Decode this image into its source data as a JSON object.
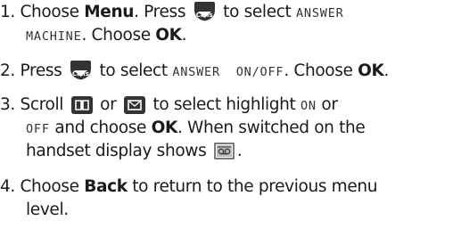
{
  "steps": [
    {
      "num": "1.",
      "l1a": "Choose ",
      "l1b": "Menu",
      "l1c": ". Press ",
      "l1d": " to select ",
      "l1e": "ANSWER",
      "l2a": "MACHINE",
      "l2b": ". Choose ",
      "l2c": "OK",
      "l2d": "."
    },
    {
      "num": "2.",
      "l1a": "Press ",
      "l1b": " to select ",
      "l1c": "ANSWER  ON/OFF",
      "l1d": ". Choose ",
      "l1e": "OK",
      "l1f": "."
    },
    {
      "num": "3.",
      "l1a": "Scroll ",
      "l1b": " or ",
      "l1c": " to select highlight ",
      "l1d": "ON",
      "l1e": " or",
      "l2a": "OFF",
      "l2b": " and choose ",
      "l2c": "OK",
      "l2d": ". When switched on the",
      "l3a": "handset display shows ",
      "l3b": "."
    },
    {
      "num": "4.",
      "l1a": "Choose ",
      "l1b": "Back",
      "l1c": " to return to the previous menu",
      "l2a": "level."
    }
  ],
  "icons": {
    "calls_key": "calls-key-icon",
    "calls_key_label": "Calls",
    "phonebook_key": "phonebook-key-icon",
    "envelope_key": "envelope-key-icon",
    "answer_machine_display": "answer-machine-display-icon"
  },
  "colors": {
    "text": "#1a1a1a",
    "key": "#333333"
  }
}
